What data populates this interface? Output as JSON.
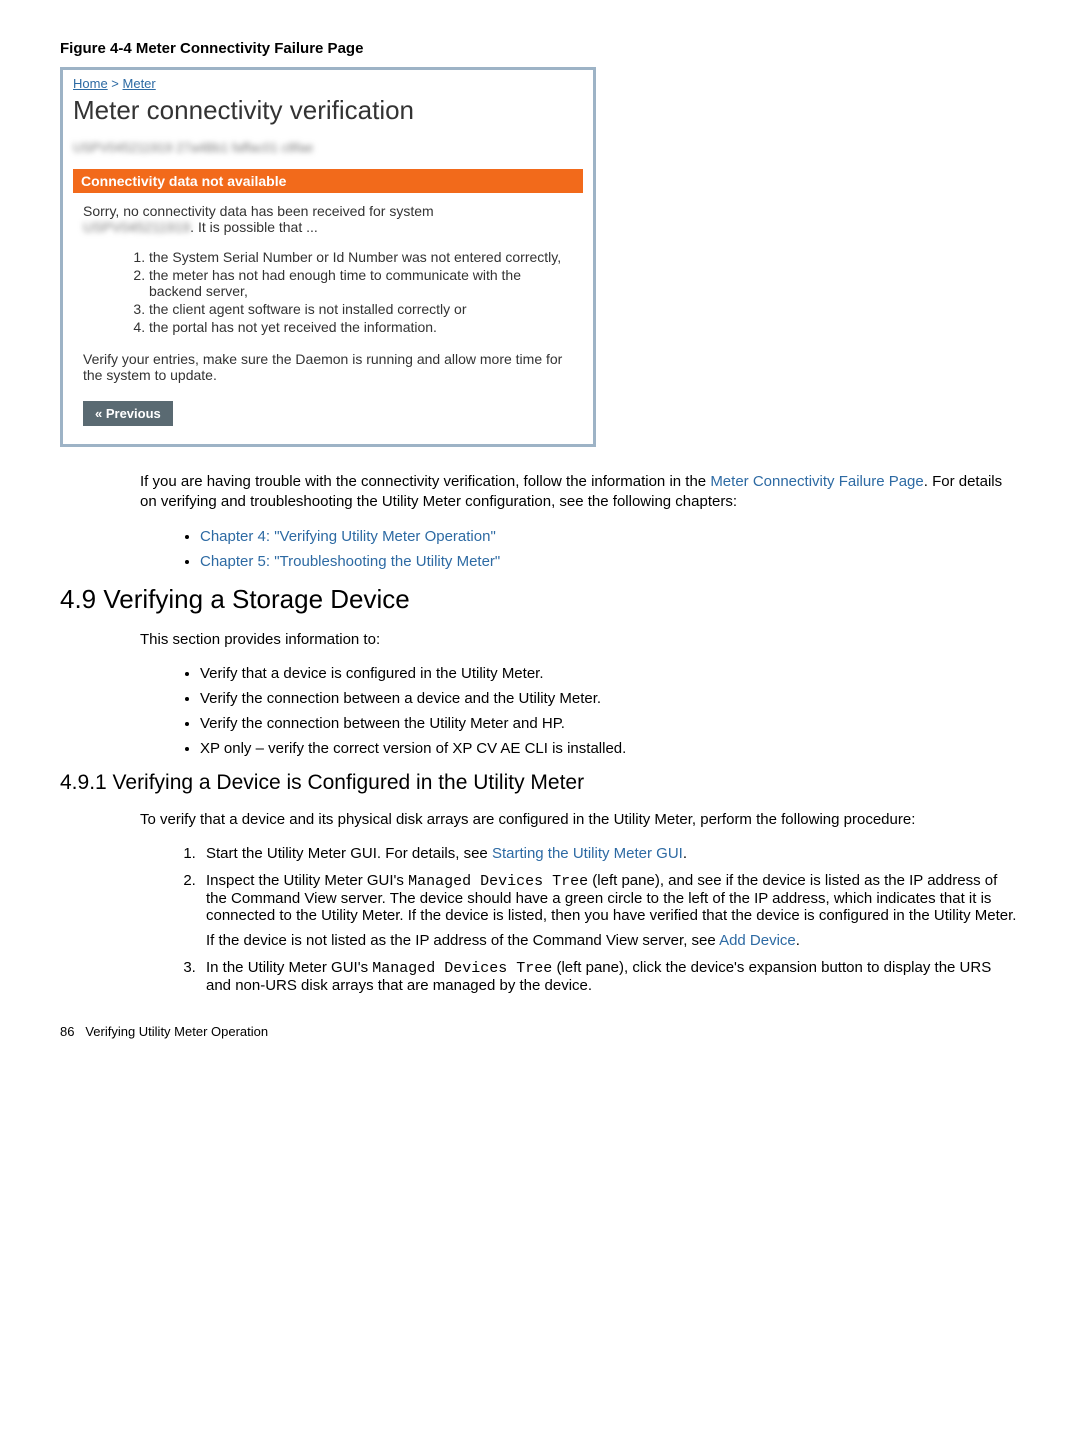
{
  "figure": {
    "caption": "Figure 4-4 Meter Connectivity Failure Page"
  },
  "screenshot": {
    "breadcrumb": {
      "home": "Home",
      "sep": " > ",
      "meter": "Meter"
    },
    "heading": "Meter connectivity verification",
    "blurred_top": "USPV045211919   27a4Bb1 faffac01 c8fae",
    "banner": "Connectivity data not available",
    "sorry_line": "Sorry, no connectivity data has been received for system",
    "sorry_blurred": "USPV045211919",
    "sorry_tail": ". It is possible that ...",
    "reasons": [
      "the System Serial Number or Id Number was not entered correctly,",
      "the meter has not had enough time to communicate with the backend server,",
      "the client agent software is not installed correctly or",
      "the portal has not yet received the information."
    ],
    "verify": "Verify your entries, make sure the Daemon is running and allow more time for the system to update.",
    "prev": "« Previous"
  },
  "para1": {
    "t1": "If you are having trouble with the connectivity verification, follow the information in the ",
    "link1": "Meter Connectivity Failure Page",
    "t2": ". For details on verifying and troubleshooting the Utility Meter configuration, see the following chapters:"
  },
  "chapters": [
    "Chapter 4: \"Verifying Utility Meter Operation\"",
    "Chapter 5: \"Troubleshooting the Utility Meter\""
  ],
  "sec49": {
    "title": "4.9 Verifying a Storage Device",
    "intro": "This section provides information to:",
    "bullets": [
      "Verify that a device is configured in the Utility Meter.",
      "Verify the connection between a device and the Utility Meter.",
      "Verify the connection between the Utility Meter and HP.",
      "XP only – verify the correct version of XP CV AE CLI is installed."
    ]
  },
  "sec491": {
    "title": "4.9.1 Verifying a Device is Configured in the Utility Meter",
    "intro": "To verify that a device and its physical disk arrays are configured in the Utility Meter, perform the following procedure:",
    "step1a": "Start the Utility Meter GUI. For details, see ",
    "step1link": "Starting the Utility Meter GUI",
    "step1b": ".",
    "step2a": "Inspect the Utility Meter GUI's ",
    "step2mono": "Managed Devices Tree",
    "step2b": " (left pane), and see if the device is listed as the IP address of the Command View server. The device should have a green circle to the left of the IP address, which indicates that it is connected to the Utility Meter. If the device is listed, then you have verified that the device is configured in the Utility Meter.",
    "step2c": "If the device is not listed as the IP address of the Command View server, see ",
    "step2link": "Add Device",
    "step2d": ".",
    "step3a": "In the Utility Meter GUI's ",
    "step3mono": "Managed Devices Tree",
    "step3b": " (left pane), click the device's expansion button to display the URS and non-URS disk arrays that are managed by the device."
  },
  "footer": {
    "page": "86",
    "title": "Verifying Utility Meter Operation"
  }
}
